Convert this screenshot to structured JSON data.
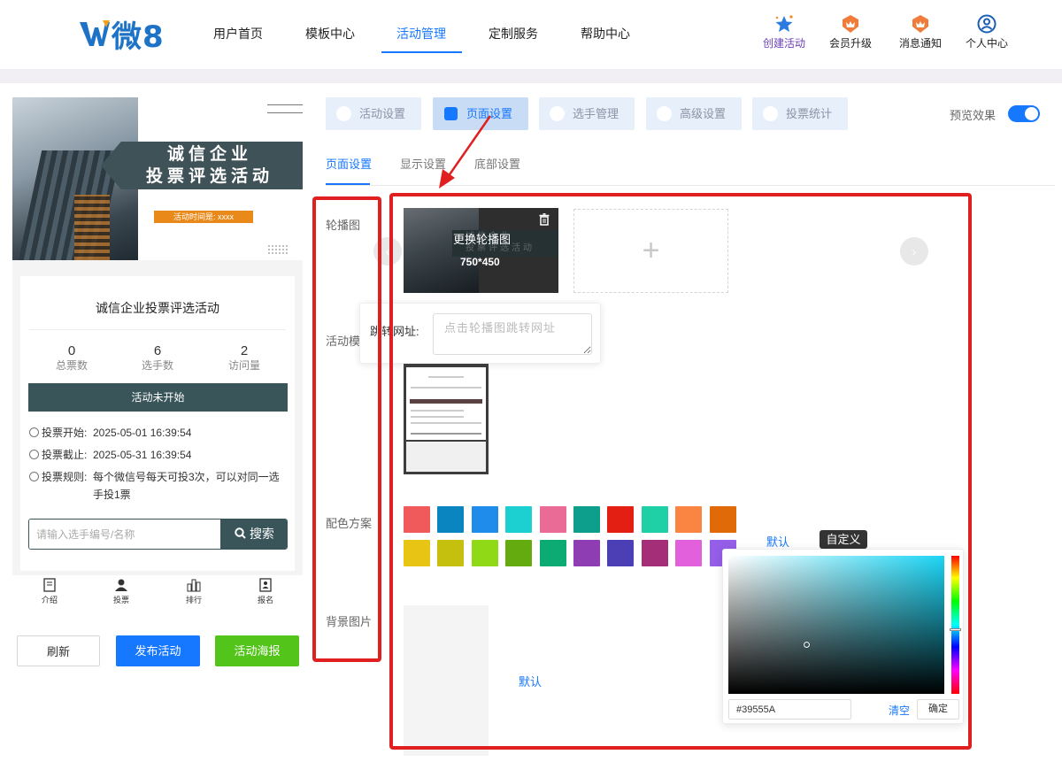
{
  "logo": {
    "text": "微8"
  },
  "nav": {
    "items": [
      "用户首页",
      "模板中心",
      "活动管理",
      "定制服务",
      "帮助中心"
    ],
    "active_index": 2
  },
  "top_actions": {
    "create": "创建活动",
    "upgrade": "会员升级",
    "notify": "消息通知",
    "profile": "个人中心"
  },
  "preview": {
    "banner": {
      "title_line1": "诚信企业",
      "title_line2": "投票评选活动",
      "time_label": "活动时间是: xxxx"
    },
    "title": "诚信企业投票评选活动",
    "stats": [
      {
        "value": "0",
        "label": "总票数"
      },
      {
        "value": "6",
        "label": "选手数"
      },
      {
        "value": "2",
        "label": "访问量"
      }
    ],
    "status": "活动未开始",
    "vote_start_label": "投票开始:",
    "vote_start": "2025-05-01 16:39:54",
    "vote_end_label": "投票截止:",
    "vote_end": "2025-05-31 16:39:54",
    "rule_label": "投票规则:",
    "rule": "每个微信号每天可投3次，可以对同一选手投1票",
    "search_placeholder": "请输入选手编号/名称",
    "search_button": "搜索",
    "tabs": [
      "介绍",
      "投票",
      "排行",
      "报名"
    ]
  },
  "buttons": {
    "refresh": "刷新",
    "publish": "发布活动",
    "poster": "活动海报"
  },
  "main_tabs": [
    "活动设置",
    "页面设置",
    "选手管理",
    "高级设置",
    "投票统计"
  ],
  "main_tab_active": 1,
  "preview_toggle": {
    "label": "预览效果",
    "on": true
  },
  "sub_tabs": [
    "页面设置",
    "显示设置",
    "底部设置"
  ],
  "labels": {
    "carousel": "轮播图",
    "template": "活动模",
    "color": "配色方案",
    "background": "背景图片"
  },
  "carousel": {
    "replace": "更换轮播图",
    "size": "750*450",
    "ghost1": "诚信企业",
    "ghost2": "投票评选活动"
  },
  "url_popup": {
    "label": "跳转网址:",
    "placeholder": "点击轮播图跳转网址"
  },
  "colors": {
    "row1": [
      "#f05a5a",
      "#0b85c0",
      "#1f8ceb",
      "#1ccfd0",
      "#e96b96",
      "#0d9e8c",
      "#e31f14",
      "#1fd0a6",
      "#fa8542",
      "#e06a08"
    ],
    "row2": [
      "#e8c415",
      "#c5bf0e",
      "#8fd916",
      "#64ab10",
      "#0cab74",
      "#8e3eb2",
      "#4c3eb4",
      "#a52e78",
      "#e360dd",
      "#955ee8"
    ]
  },
  "color_default": "默认",
  "color_custom": "自定义",
  "picker": {
    "value": "#39555A",
    "clear": "清空",
    "confirm": "确定"
  },
  "background_default": "默认",
  "highlight_color": "#e02020",
  "accent": "#1677ff",
  "theme": "#39555a"
}
